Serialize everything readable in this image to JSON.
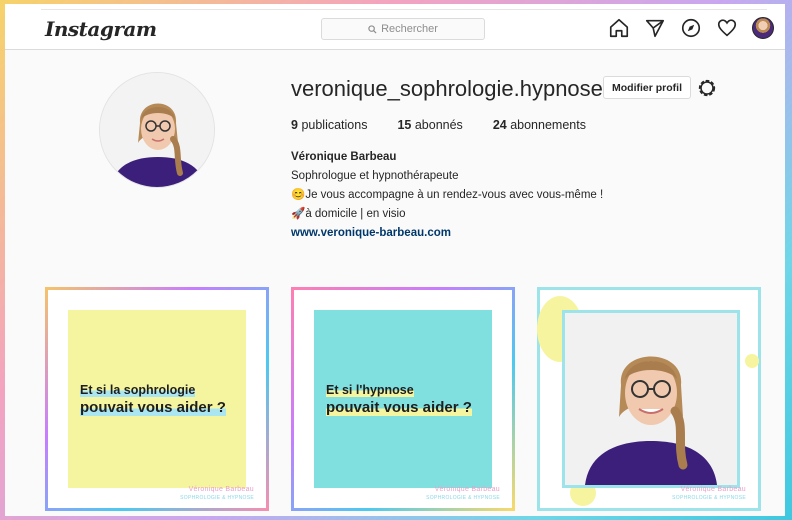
{
  "nav": {
    "logo": "Instagram",
    "search_placeholder": "Rechercher",
    "icons": [
      "home-icon",
      "direct-icon",
      "explore-icon",
      "activity-icon",
      "profile-avatar"
    ]
  },
  "profile": {
    "username": "veronique_sophrologie.hypnose",
    "edit_label": "Modifier profil",
    "stats": {
      "posts_count": "9",
      "posts_label": "publications",
      "followers_count": "15",
      "followers_label": "abonnés",
      "following_count": "24",
      "following_label": "abonnements"
    },
    "bio": {
      "name": "Véronique Barbeau",
      "line1": "Sophrologue et hypnothérapeute",
      "line2": "😊Je vous accompagne à un rendez-vous avec vous-même !",
      "line3": "🚀à domicile | en visio",
      "link": "www.veronique-barbeau.com"
    }
  },
  "posts": [
    {
      "line1": "Et si la sophrologie",
      "line2": "pouvait vous aider ?",
      "brand": "Véronique Barbeau",
      "brand_sub": "SOPHROLOGIE & HYPNOSE",
      "bg": "#f5f5a0"
    },
    {
      "line1": "Et si l'hypnose",
      "line2": "pouvait vous aider ?",
      "brand": "Véronique Barbeau",
      "brand_sub": "SOPHROLOGIE & HYPNOSE",
      "bg": "#80e0e0"
    },
    {
      "brand": "Véronique Barbeau",
      "brand_sub": "SOPHROLOGIE & HYPNOSE"
    }
  ]
}
